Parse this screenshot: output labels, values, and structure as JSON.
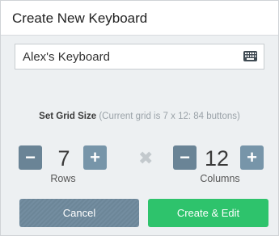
{
  "dialog": {
    "title": "Create New Keyboard",
    "name_value": "Alex's Keyboard"
  },
  "grid": {
    "label_strong": "Set Grid Size",
    "label_note": "(Current grid is 7 x 12: 84 buttons)"
  },
  "rows": {
    "value": "7",
    "caption": "Rows"
  },
  "columns": {
    "value": "12",
    "caption": "Columns"
  },
  "stepper": {
    "minus": "−",
    "plus": "+"
  },
  "times_glyph": "✖",
  "actions": {
    "cancel": "Cancel",
    "create": "Create & Edit"
  },
  "colors": {
    "accent_green": "#2ec36c",
    "stepper_blue": "#6a8496",
    "background": "#edf0f2"
  },
  "icons": {
    "keyboard": "keyboard-icon",
    "times": "times-icon"
  }
}
